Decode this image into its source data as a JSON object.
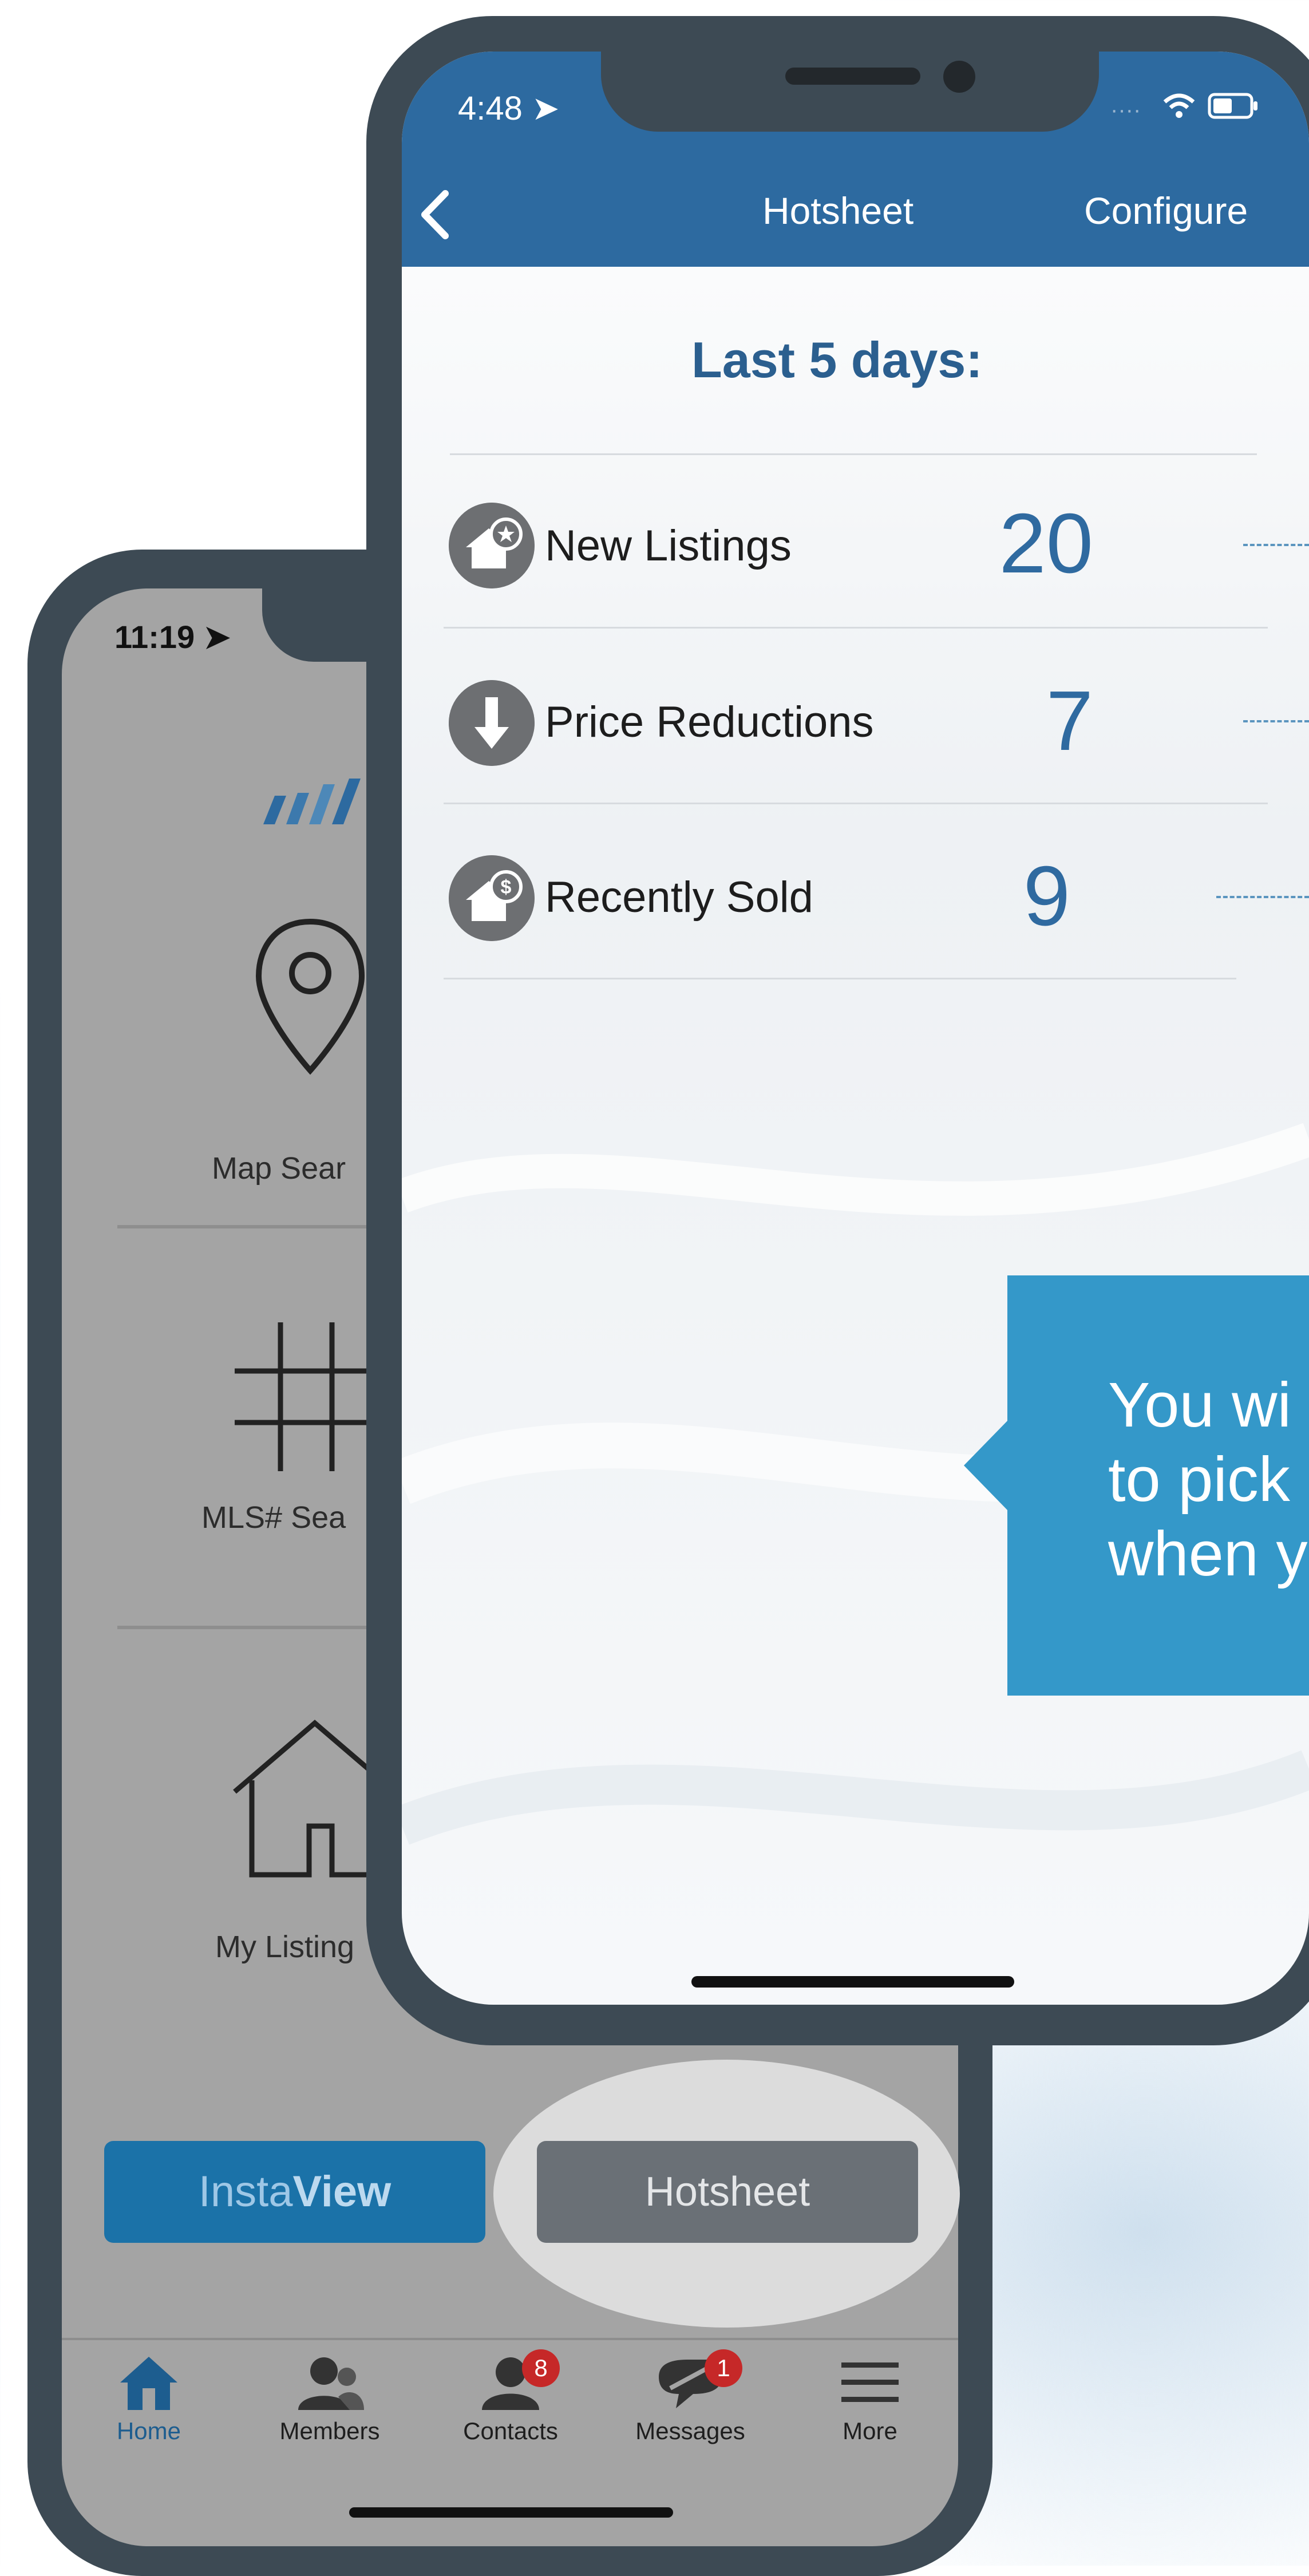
{
  "back_phone": {
    "status_time": "11:19",
    "menu": [
      {
        "label": "Map Sear",
        "icon": "map-pin-icon"
      },
      {
        "label": "MLS# Sea",
        "icon": "hash-icon"
      },
      {
        "label": "My Listing",
        "icon": "house-icon"
      }
    ],
    "buttons": {
      "instaview_prefix": "Insta",
      "instaview_bold": "View",
      "hotsheet": "Hotsheet"
    },
    "tabs": [
      {
        "label": "Home",
        "icon": "home-icon",
        "active": true
      },
      {
        "label": "Members",
        "icon": "members-icon"
      },
      {
        "label": "Contacts",
        "icon": "contacts-icon",
        "badge": "8"
      },
      {
        "label": "Messages",
        "icon": "messages-icon",
        "badge": "1"
      },
      {
        "label": "More",
        "icon": "menu-icon"
      }
    ]
  },
  "front_phone": {
    "status_time": "4:48",
    "nav": {
      "title": "Hotsheet",
      "right": "Configure",
      "back_icon": "chevron-left-icon"
    },
    "heading": "Last 5 days:",
    "rows": [
      {
        "label": "New Listings",
        "count": "20",
        "icon": "new-listing-icon"
      },
      {
        "label": "Price Reductions",
        "count": "7",
        "icon": "arrow-down-icon"
      },
      {
        "label": "Recently Sold",
        "count": "9",
        "icon": "sold-icon"
      }
    ]
  },
  "callout": {
    "lines": [
      "You wi",
      "to pick",
      "when y"
    ]
  },
  "colors": {
    "brand_blue": "#2d6aa0",
    "count_blue": "#2f6aa0",
    "callout_blue": "#3498c9",
    "badge_red": "#c62828"
  }
}
